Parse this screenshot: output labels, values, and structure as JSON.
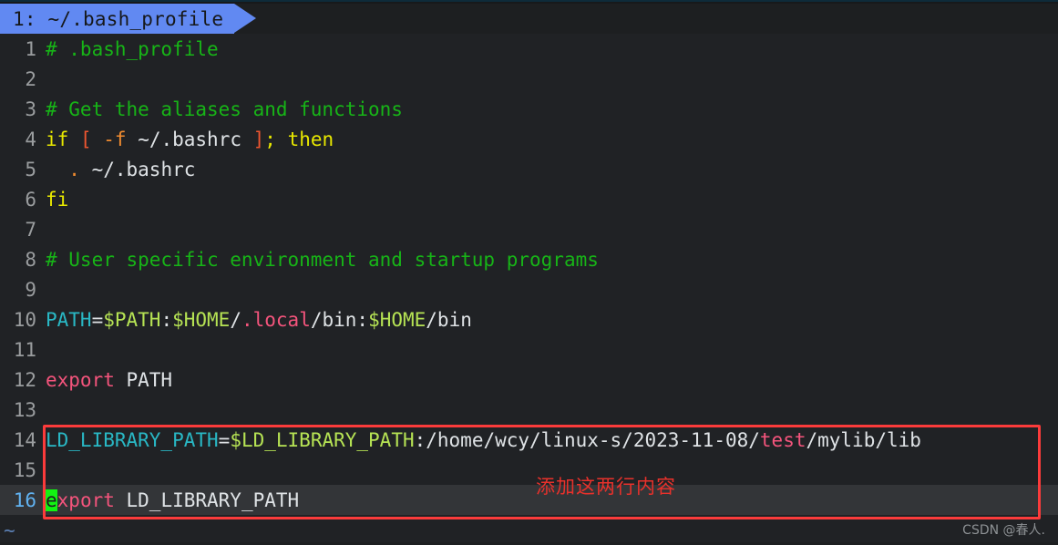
{
  "window": {
    "app": "vim",
    "background": "#202225"
  },
  "tabline": {
    "tabs": [
      {
        "label": "1: ~/.bash_profile",
        "active": true,
        "bg": "#6189f2",
        "fg": "#16181a"
      }
    ]
  },
  "editor": {
    "filler_char": "~",
    "cursor": {
      "line": 16,
      "column": 1,
      "char": "e",
      "color": "#12f312"
    },
    "current_line": 16,
    "lines": [
      {
        "no": "1",
        "tokens": [
          {
            "t": "# .bash_profile",
            "c": "c-comment"
          }
        ]
      },
      {
        "no": "2",
        "tokens": []
      },
      {
        "no": "3",
        "tokens": [
          {
            "t": "# Get the aliases and functions",
            "c": "c-comment"
          }
        ]
      },
      {
        "no": "4",
        "tokens": [
          {
            "t": "if ",
            "c": "c-keyword"
          },
          {
            "t": "[",
            "c": "c-bracket"
          },
          {
            "t": " ",
            "c": "c-plain"
          },
          {
            "t": "-f",
            "c": "c-flag"
          },
          {
            "t": " ~/.bashrc ",
            "c": "c-plain"
          },
          {
            "t": "]",
            "c": "c-bracket"
          },
          {
            "t": ";",
            "c": "c-keyword"
          },
          {
            "t": " ",
            "c": "c-plain"
          },
          {
            "t": "then",
            "c": "c-keyword"
          }
        ]
      },
      {
        "no": "5",
        "tokens": [
          {
            "t": "  ",
            "c": "c-plain"
          },
          {
            "t": ".",
            "c": "c-dot"
          },
          {
            "t": " ~/.bashrc",
            "c": "c-plain"
          }
        ]
      },
      {
        "no": "6",
        "tokens": [
          {
            "t": "fi",
            "c": "c-keyword"
          }
        ]
      },
      {
        "no": "7",
        "tokens": []
      },
      {
        "no": "8",
        "tokens": [
          {
            "t": "# User specific environment and startup programs",
            "c": "c-comment"
          }
        ]
      },
      {
        "no": "9",
        "tokens": []
      },
      {
        "no": "10",
        "tokens": [
          {
            "t": "PATH",
            "c": "c-ident"
          },
          {
            "t": "=",
            "c": "c-op"
          },
          {
            "t": "$PATH",
            "c": "c-var"
          },
          {
            "t": ":",
            "c": "c-op"
          },
          {
            "t": "$HOME",
            "c": "c-var"
          },
          {
            "t": "/",
            "c": "c-op"
          },
          {
            "t": ".local",
            "c": "c-pink"
          },
          {
            "t": "/bin:",
            "c": "c-op"
          },
          {
            "t": "$HOME",
            "c": "c-var"
          },
          {
            "t": "/bin",
            "c": "c-op"
          }
        ]
      },
      {
        "no": "11",
        "tokens": []
      },
      {
        "no": "12",
        "tokens": [
          {
            "t": "export",
            "c": "c-pink"
          },
          {
            "t": " PATH",
            "c": "c-plain"
          }
        ]
      },
      {
        "no": "13",
        "tokens": []
      },
      {
        "no": "14",
        "tokens": [
          {
            "t": "LD_LIBRARY_PATH",
            "c": "c-ident"
          },
          {
            "t": "=",
            "c": "c-op"
          },
          {
            "t": "$LD_LIBRARY_PATH",
            "c": "c-var"
          },
          {
            "t": ":/home/wcy/linux-s/2023-11-08/",
            "c": "c-plain"
          },
          {
            "t": "test",
            "c": "c-pink"
          },
          {
            "t": "/mylib/lib",
            "c": "c-plain"
          }
        ]
      },
      {
        "no": "15",
        "tokens": []
      },
      {
        "no": "16",
        "tokens": [
          {
            "t": "e",
            "c": "cursor"
          },
          {
            "t": "xport",
            "c": "c-pink"
          },
          {
            "t": " LD_LIBRARY_PATH",
            "c": "c-plain"
          }
        ]
      }
    ]
  },
  "annotation": {
    "text": "添加这两行内容",
    "color": "#e8312b",
    "box_color": "#fb3b3b"
  },
  "watermark": {
    "text": "CSDN @春人."
  }
}
